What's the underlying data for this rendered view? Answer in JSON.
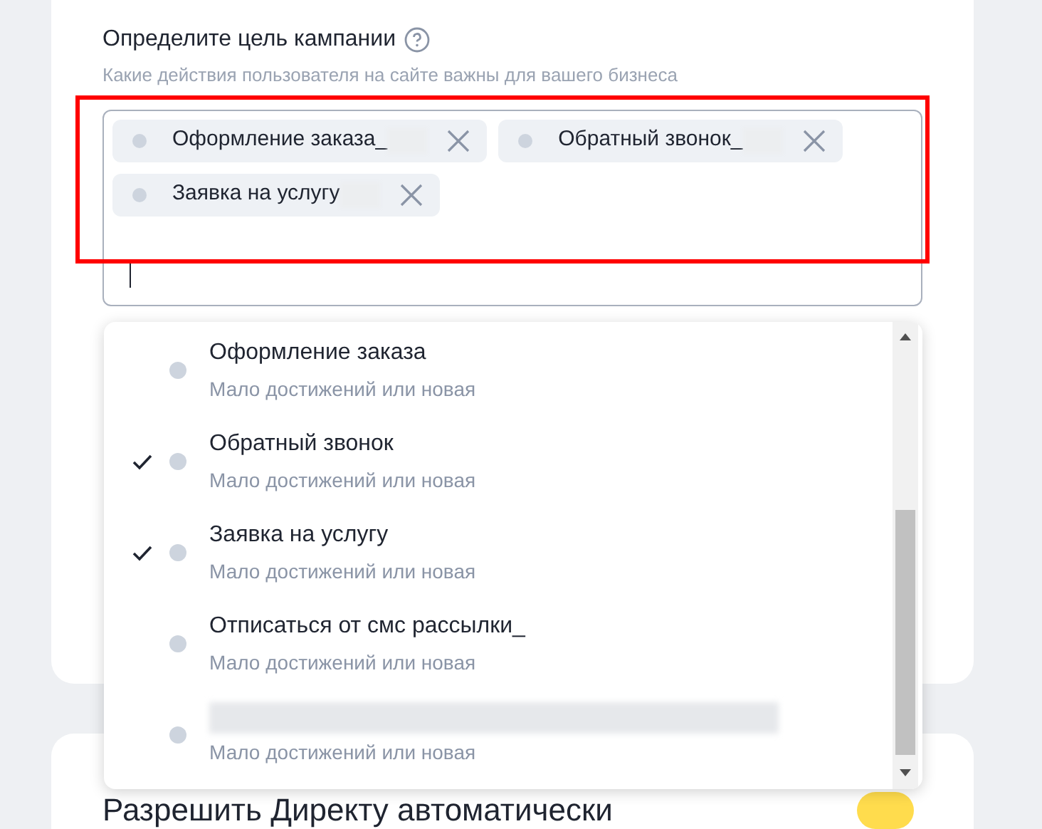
{
  "goal_section": {
    "title": "Определите цель кампании",
    "subtitle": "Какие действия пользователя на сайте важны для вашего бизнеса"
  },
  "selected_goals": [
    {
      "label": "Оформление заказа_"
    },
    {
      "label": "Обратный звонок_"
    },
    {
      "label": "Заявка на услугу"
    }
  ],
  "goal_options": [
    {
      "title": "Оформление заказа",
      "subtitle": "Мало достижений или новая",
      "checked": false
    },
    {
      "title": "Обратный звонок",
      "subtitle": "Мало достижений или новая",
      "checked": true
    },
    {
      "title": "Заявка на услугу",
      "subtitle": "Мало достижений или новая",
      "checked": true
    },
    {
      "title": "Отписаться от смс рассылки_",
      "subtitle": "Мало достижений или новая",
      "checked": false
    },
    {
      "subtitle": "Мало достижений или новая",
      "checked": false
    }
  ],
  "next_section": {
    "title": "Разрешить Директу автоматически",
    "toggle_on": true
  }
}
